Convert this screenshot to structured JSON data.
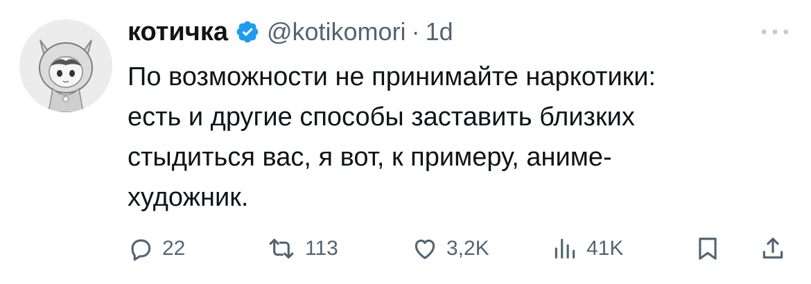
{
  "tweet": {
    "author": {
      "name": "котичка",
      "handle": "@kotikomori",
      "verified": true,
      "avatar_icon": "anime-girl-avatar-icon"
    },
    "separator": "·",
    "time": "1d",
    "text_lines": [
      "По возможности не принимайте наркотики:",
      "есть и другие способы заставить близких",
      "стыдиться вас, я вот, к примеру, аниме-",
      "художник."
    ],
    "actions": {
      "replies": "22",
      "retweets": "113",
      "likes": "3,2K",
      "views": "41K"
    },
    "icons": [
      "more-icon",
      "reply-icon",
      "retweet-icon",
      "like-icon",
      "views-icon",
      "bookmark-icon",
      "share-icon"
    ]
  },
  "colors": {
    "text": "#0f1419",
    "muted": "#536471",
    "verified": "#1d9bf0",
    "background": "#ffffff"
  }
}
